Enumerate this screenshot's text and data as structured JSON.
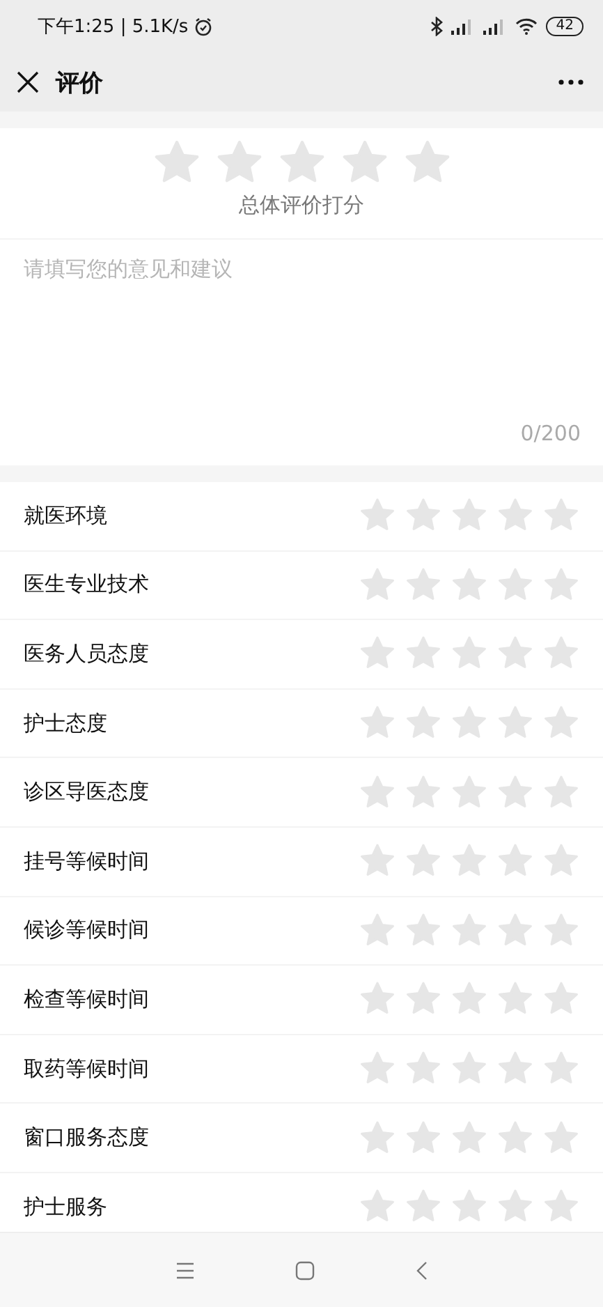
{
  "status_bar": {
    "time": "下午1:25 | 5.1K/s",
    "battery": "42"
  },
  "header": {
    "title": "评价"
  },
  "overall": {
    "stars": 0,
    "label": "总体评价打分"
  },
  "comment": {
    "placeholder": "请填写您的意见和建议",
    "counter": "0/200"
  },
  "ratings": [
    {
      "label": "就医环境",
      "stars": 0
    },
    {
      "label": "医生专业技术",
      "stars": 0
    },
    {
      "label": "医务人员态度",
      "stars": 0
    },
    {
      "label": "护士态度",
      "stars": 0
    },
    {
      "label": "诊区导医态度",
      "stars": 0
    },
    {
      "label": "挂号等候时间",
      "stars": 0
    },
    {
      "label": "候诊等候时间",
      "stars": 0
    },
    {
      "label": "检查等候时间",
      "stars": 0
    },
    {
      "label": "取药等候时间",
      "stars": 0
    },
    {
      "label": "窗口服务态度",
      "stars": 0
    },
    {
      "label": "护士服务",
      "stars": 0
    }
  ]
}
